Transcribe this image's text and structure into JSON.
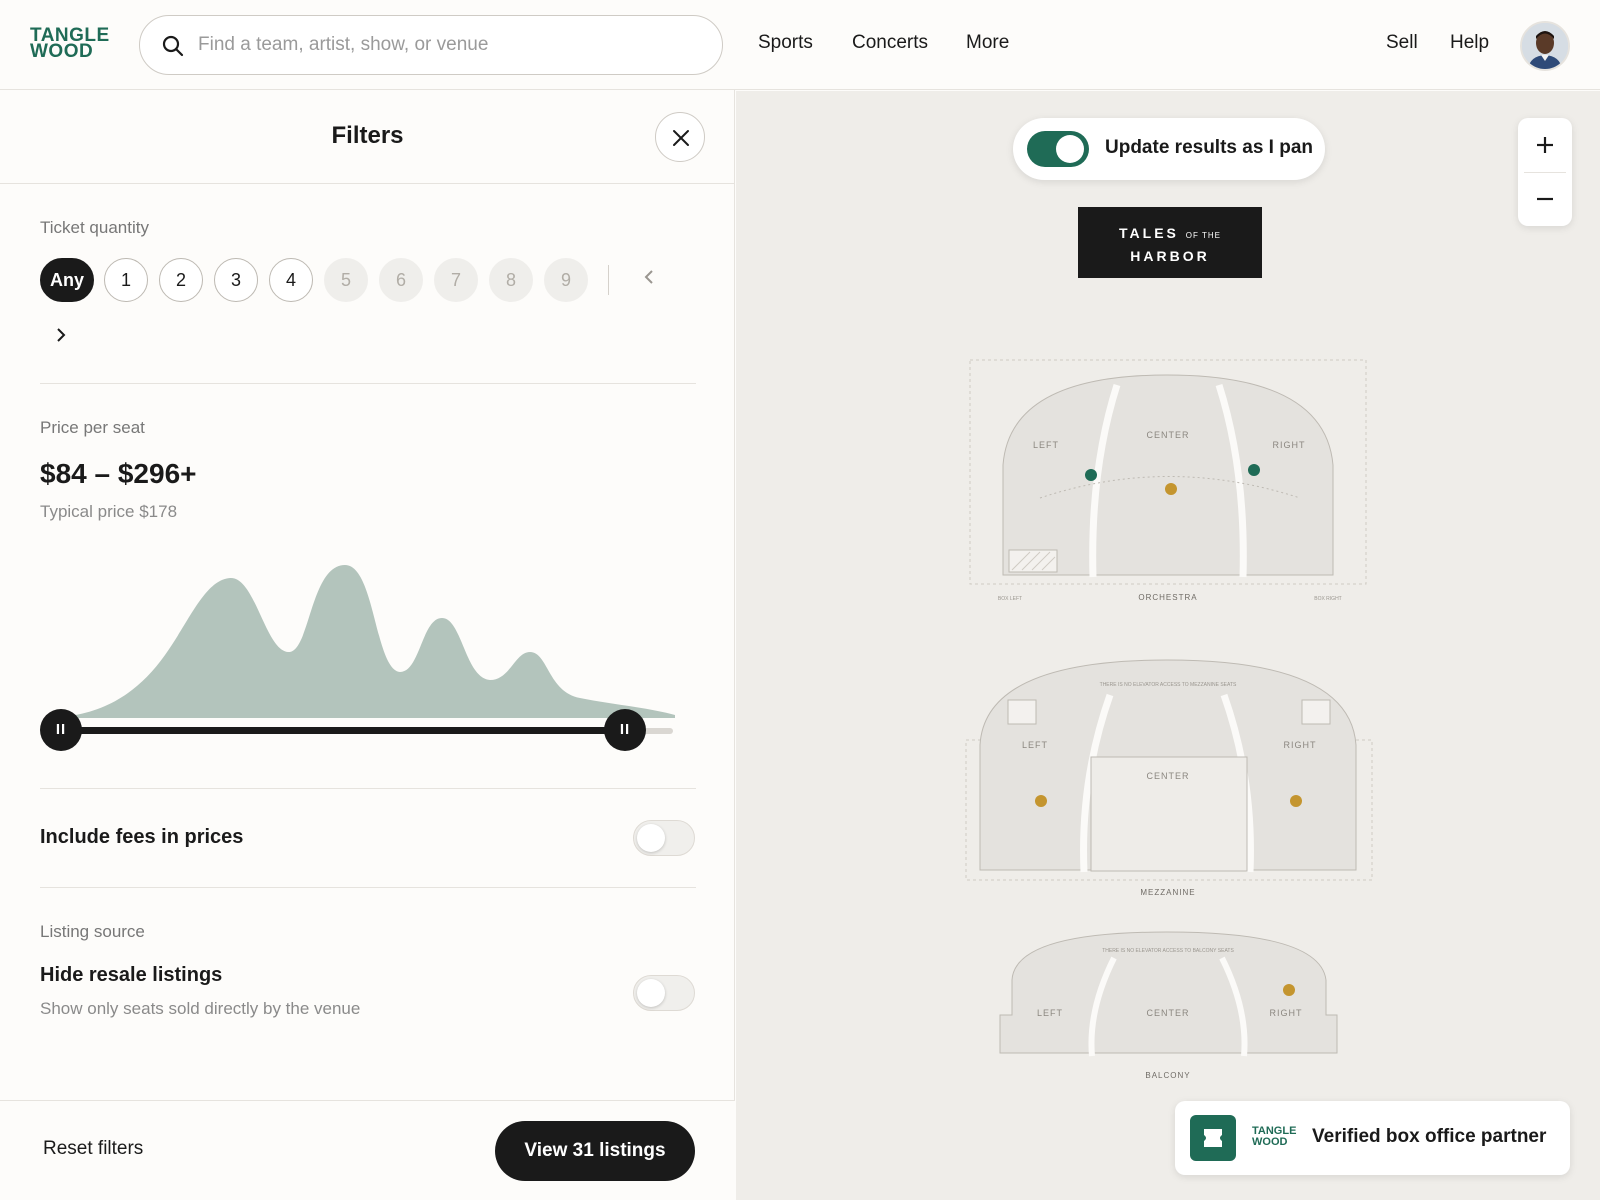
{
  "header": {
    "logo": {
      "line1": "TANGLE",
      "line2": "WOOD"
    },
    "search": {
      "placeholder": "Find a team, artist, show, or venue",
      "value": ""
    },
    "nav": [
      "Sports",
      "Concerts",
      "More"
    ],
    "right_links": [
      "Sell",
      "Help"
    ]
  },
  "filters": {
    "title": "Filters",
    "ticket_quantity": {
      "label": "Ticket quantity",
      "options": [
        "Any",
        "1",
        "2",
        "3",
        "4",
        "5",
        "6",
        "7",
        "8",
        "9"
      ],
      "selected": "Any",
      "disabled": [
        "5",
        "6",
        "7",
        "8",
        "9"
      ]
    },
    "price": {
      "label": "Price per seat",
      "range": "$84 – $296+",
      "typical": "Typical price $178",
      "min_selected_fraction": 0.0,
      "max_selected_fraction": 0.92,
      "handle_glyph": "II"
    },
    "include_fees": {
      "label": "Include fees in prices",
      "on": false
    },
    "listing_source": {
      "label": "Listing source",
      "hide_resale": {
        "label": "Hide resale listings",
        "sublabel": "Show only seats sold directly by the venue",
        "on": false
      }
    },
    "reset_label": "Reset filters",
    "view_label": "View 31 listings"
  },
  "map": {
    "pan_toggle": {
      "label": "Update results as I pan",
      "on": true
    },
    "zoom_in": "+",
    "zoom_out": "–",
    "show_logo": {
      "word1": "TALES",
      "small": "OF THE",
      "word2": "HARBOR"
    },
    "sections": {
      "orchestra": {
        "name": "ORCHESTRA",
        "left": "LEFT",
        "center": "CENTER",
        "right": "RIGHT",
        "box_left": "BOX LEFT",
        "box_right": "BOX RIGHT"
      },
      "mezzanine": {
        "name": "MEZZANINE",
        "left": "LEFT",
        "center": "CENTER",
        "right": "RIGHT",
        "note": "THERE IS NO ELEVATOR ACCESS TO MEZZANINE SEATS"
      },
      "balcony": {
        "name": "BALCONY",
        "left": "LEFT",
        "center": "CENTER",
        "right": "RIGHT",
        "note": "THERE IS NO ELEVATOR ACCESS TO BALCONY SEATS"
      }
    },
    "partner": {
      "logo_line1": "TANGLE",
      "logo_line2": "WOOD",
      "text": "Verified box office partner"
    }
  },
  "colors": {
    "brand_green": "#1f6b56",
    "listing_green": "#1f6b56",
    "listing_gold": "#c4952f",
    "histogram_fill": "#b3c4bc"
  },
  "icons": [
    "search-icon",
    "close-icon",
    "chevron-left-icon",
    "chevron-right-icon",
    "plus-icon",
    "minus-icon",
    "ticket-icon"
  ]
}
